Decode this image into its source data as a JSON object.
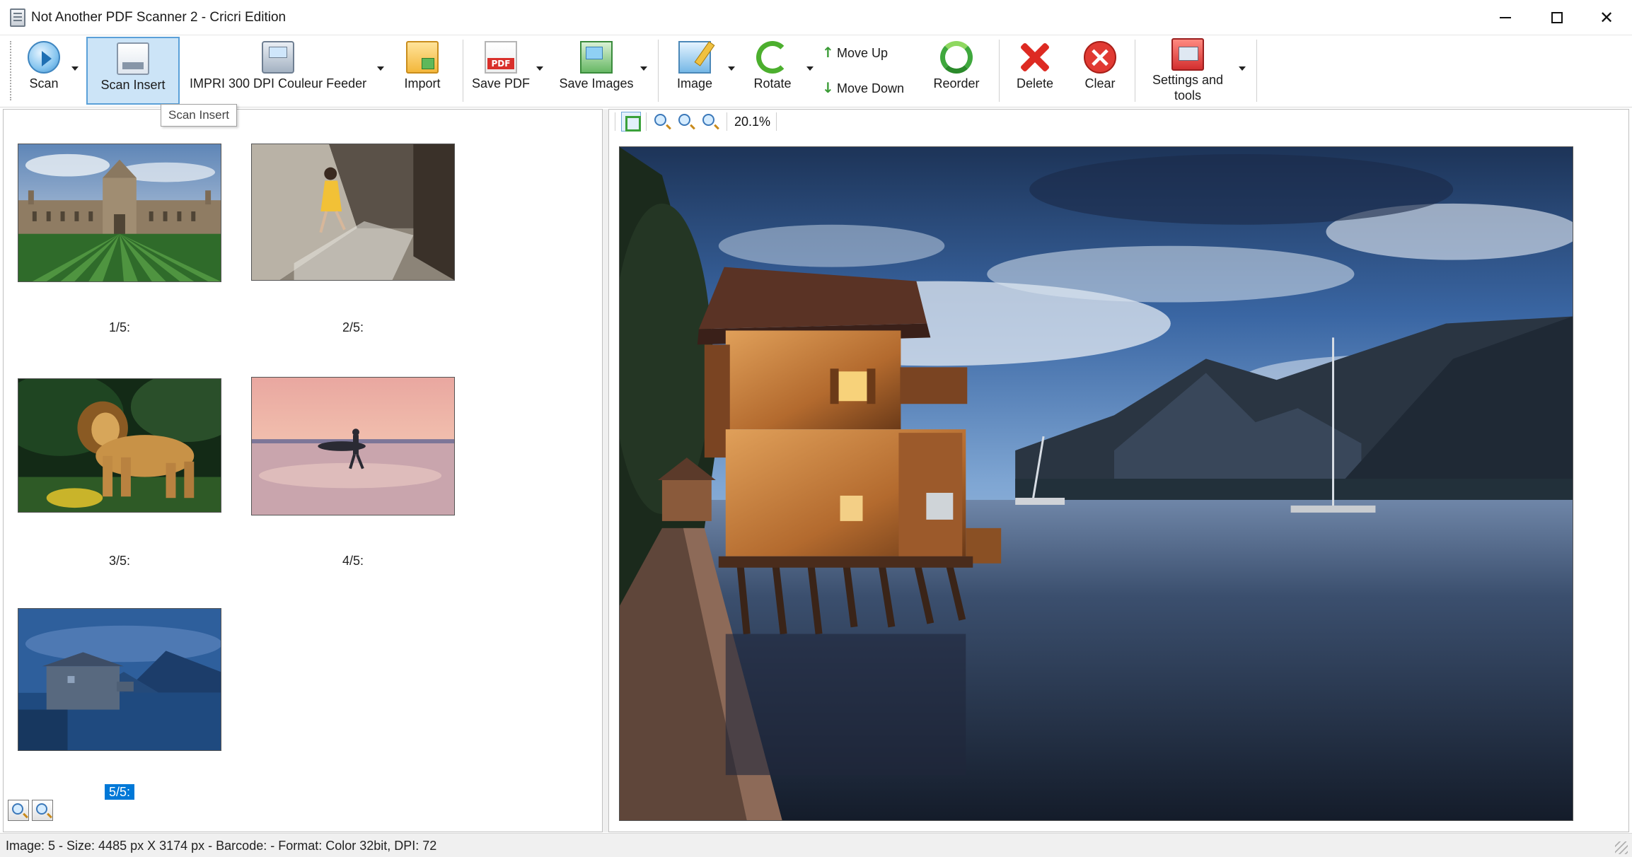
{
  "window": {
    "title": "Not Another PDF Scanner 2 - Cricri Edition"
  },
  "toolbar": {
    "scan": "Scan",
    "scan_insert": "Scan Insert",
    "device": "IMPRI 300 DPI Couleur Feeder",
    "import": "Import",
    "save_pdf": "Save PDF",
    "save_images": "Save Images",
    "image": "Image",
    "rotate": "Rotate",
    "move_up": "Move Up",
    "move_down": "Move Down",
    "reorder": "Reorder",
    "delete": "Delete",
    "clear": "Clear",
    "settings_line1": "Settings and",
    "settings_line2": "tools"
  },
  "tooltip": "Scan Insert",
  "thumbnails": [
    {
      "caption": "1/5:",
      "subject": "college building and striped lawn"
    },
    {
      "caption": "2/5:",
      "subject": "child in yellow dress in sunlit corridor"
    },
    {
      "caption": "3/5:",
      "subject": "lion standing in grass"
    },
    {
      "caption": "4/5:",
      "subject": "surfer at sunset on beach"
    },
    {
      "caption": "5/5:",
      "subject": "boathouse on lake",
      "selected": true
    }
  ],
  "viewer": {
    "zoom": "20.1%"
  },
  "status": "Image: 5 - Size: 4485 px X 3174 px  - Barcode:  - Format: Color 32bit, DPI: 72",
  "colors": {
    "accent": "#0078d7",
    "active_button": "#cce4f7"
  }
}
